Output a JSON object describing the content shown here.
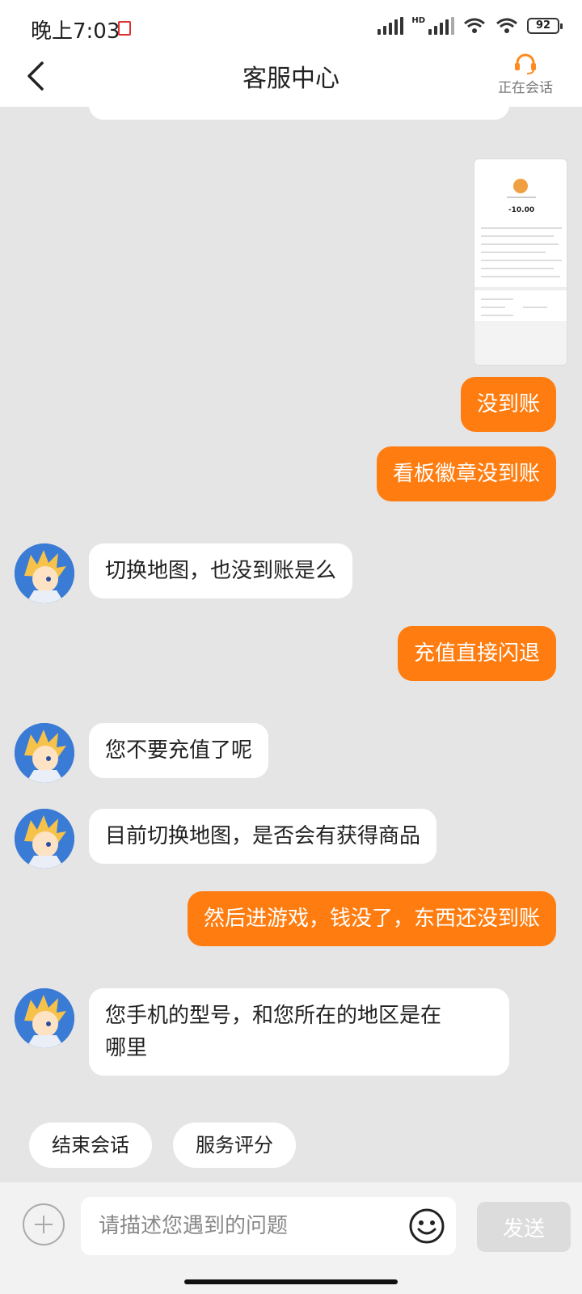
{
  "status_bar": {
    "time": "晚上7:03",
    "hd": "HD",
    "battery": "92"
  },
  "header": {
    "title": "客服中心",
    "status_label": "正在会话"
  },
  "messages": {
    "m1": "没到账",
    "m2": "看板徽章没到账",
    "m3": "切换地图，也没到账是么",
    "m4": "充值直接闪退",
    "m5": "您不要充值了呢",
    "m6": "目前切换地图，是否会有获得商品",
    "m7": "然后进游戏，钱没了，东西还没到账",
    "m8_line1": "您手机的型号，和您所在的地区是在",
    "m8_line2": "哪里"
  },
  "screenshot_thumb": {
    "amount": "-10.00"
  },
  "quick_actions": {
    "end": "结束会话",
    "rate": "服务评分"
  },
  "input": {
    "placeholder": "请描述您遇到的问题",
    "send_label": "发送"
  },
  "colors": {
    "outgoing": "#ff7d10",
    "incoming": "#ffffff",
    "background": "#e5e5e5",
    "accent_icon": "#ff8a1e"
  },
  "icons": [
    "back-arrow-icon",
    "headset-icon",
    "add-icon",
    "emoji-icon",
    "avatar"
  ]
}
